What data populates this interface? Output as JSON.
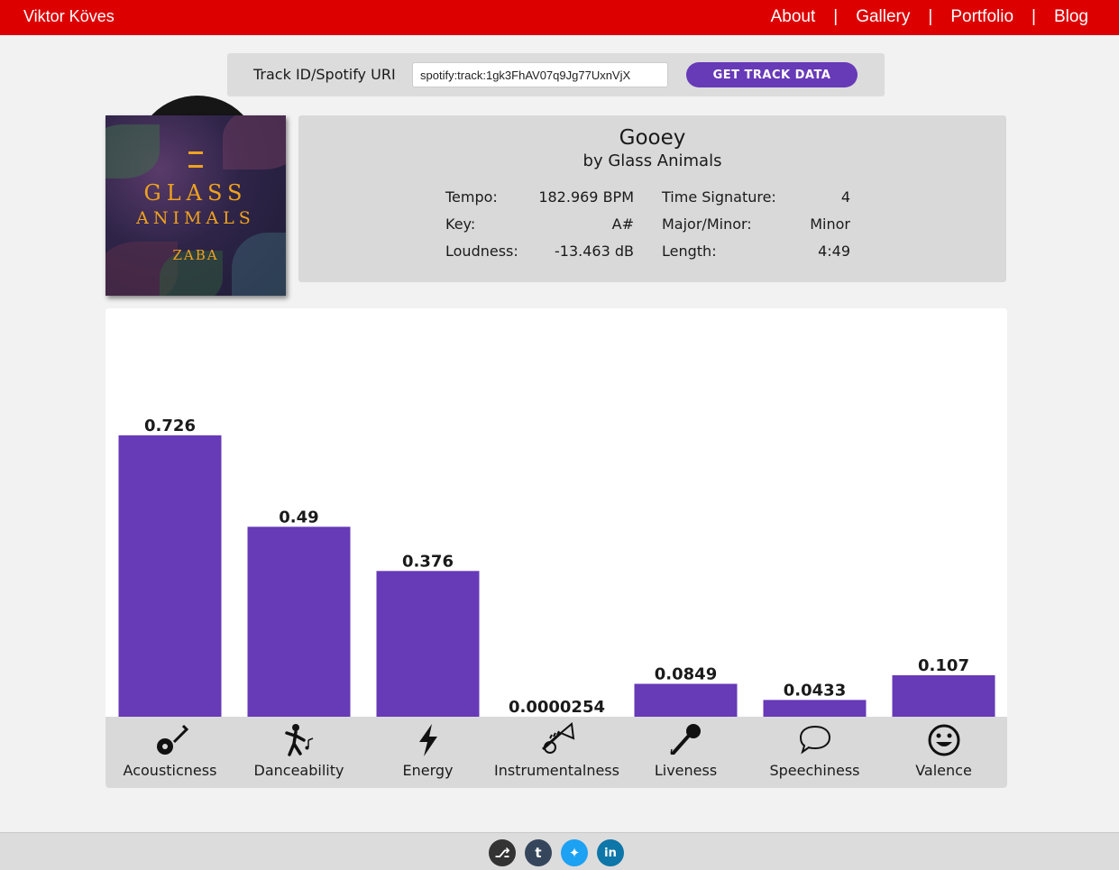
{
  "nav": {
    "brand": "Viktor Köves",
    "links": [
      "About",
      "Gallery",
      "Portfolio",
      "Blog"
    ],
    "separator": "|"
  },
  "search": {
    "label": "Track ID/Spotify URI",
    "value": "spotify:track:1gk3FhAV07q9Jg77UxnVjX",
    "button": "GET TRACK DATA"
  },
  "album": {
    "line1": "GLASS",
    "line2": "ANIMALS",
    "line3": "ZABA"
  },
  "track": {
    "name": "Gooey",
    "artist": "by Glass Animals",
    "stats": {
      "tempo_label": "Tempo:",
      "tempo": "182.969 BPM",
      "key_label": "Key:",
      "key": "A#",
      "loudness_label": "Loudness:",
      "loudness": "-13.463 dB",
      "timesig_label": "Time Signature:",
      "timesig": "4",
      "mode_label": "Major/Minor:",
      "mode": "Minor",
      "length_label": "Length:",
      "length": "4:49"
    }
  },
  "colors": {
    "topbar": "#dd0000",
    "accent": "#673ab7",
    "bar": "#673ab7"
  },
  "chart_data": {
    "type": "bar",
    "categories": [
      "Acousticness",
      "Danceability",
      "Energy",
      "Instrumentalness",
      "Liveness",
      "Speechiness",
      "Valence"
    ],
    "values": [
      0.726,
      0.49,
      0.376,
      2.54e-05,
      0.0849,
      0.0433,
      0.107
    ],
    "value_labels": [
      "0.726",
      "0.49",
      "0.376",
      "0.0000254",
      "0.0849",
      "0.0433",
      "0.107"
    ],
    "icons": [
      "guitar-icon",
      "dancer-icon",
      "lightning-icon",
      "trumpet-icon",
      "microphone-icon",
      "speech-bubble-icon",
      "smiley-icon"
    ],
    "ylim": [
      0,
      1
    ],
    "grid": false,
    "legend": "none"
  },
  "footer": {
    "social": [
      {
        "name": "github-icon",
        "glyph": "⎇",
        "color": "#333333"
      },
      {
        "name": "tumblr-icon",
        "glyph": "t",
        "color": "#35465c"
      },
      {
        "name": "twitter-icon",
        "glyph": "✦",
        "color": "#1da1f2"
      },
      {
        "name": "linkedin-icon",
        "glyph": "in",
        "color": "#0e76a8"
      }
    ]
  }
}
